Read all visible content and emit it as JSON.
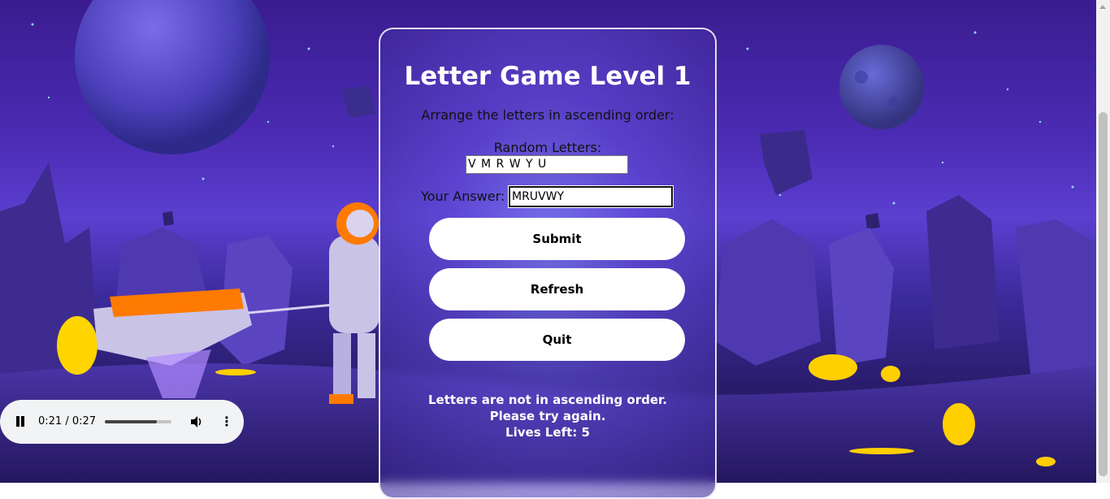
{
  "game": {
    "title": "Letter Game Level 1",
    "instruction": "Arrange the letters in ascending order:",
    "random_label": "Random Letters:",
    "random_letters": "V M R W Y U",
    "answer_label": "Your Answer:",
    "answer_value": "MRUVWY",
    "submit_label": "Submit",
    "refresh_label": "Refresh",
    "quit_label": "Quit",
    "message": "Letters are not in ascending order. Please try again.",
    "lives": "Lives Left: 5"
  },
  "audio": {
    "time": "0:21 / 0:27",
    "progress": 0.78,
    "icons": {
      "play": "pause-icon",
      "volume": "volume-icon",
      "more": "more-options-icon"
    }
  },
  "colors": {
    "panel_border": "#ffffff",
    "button_bg": "#ffffff",
    "title_color": "#ffffff"
  }
}
